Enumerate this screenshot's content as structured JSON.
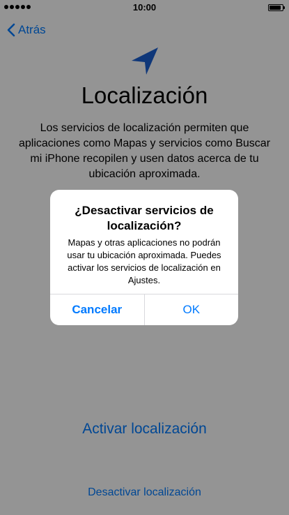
{
  "status_bar": {
    "time": "10:00",
    "battery_level": 0.9
  },
  "nav": {
    "back_label": "Atrás"
  },
  "page": {
    "icon": "location-arrow-icon",
    "title": "Localización",
    "description": "Los servicios de localización permiten que aplicaciones como Mapas y servicios como Buscar mi iPhone recopilen y usen datos acerca de tu ubicación aproximada.",
    "enable_label": "Activar localización",
    "disable_label": "Desactivar localización"
  },
  "alert": {
    "title": "¿Desactivar servicios de localización?",
    "message": "Mapas y otras aplicaciones no podrán usar tu ubicación aproximada. Puedes activar los servicios de localización en Ajustes.",
    "cancel_label": "Cancelar",
    "ok_label": "OK"
  },
  "colors": {
    "accent": "#007aff",
    "icon_blue": "#1a5fd0",
    "overlay": "rgba(0,0,0,0.42)"
  }
}
